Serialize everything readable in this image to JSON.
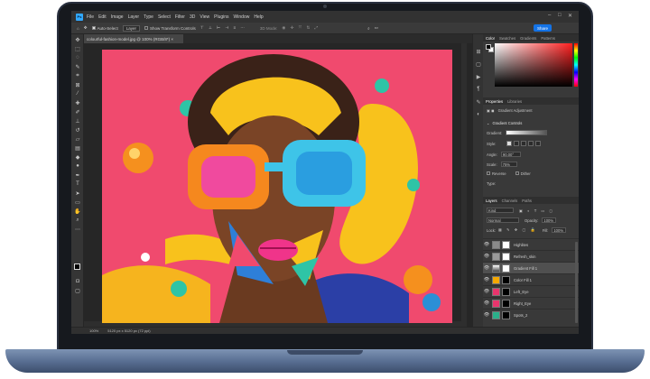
{
  "menubar": {
    "app_logo": "Ps",
    "items": [
      "File",
      "Edit",
      "Image",
      "Layer",
      "Type",
      "Select",
      "Filter",
      "3D",
      "View",
      "Plugins",
      "Window",
      "Help"
    ],
    "window_controls": [
      "–",
      "□",
      "✕"
    ]
  },
  "options_bar": {
    "auto_select_label": "Auto-Select",
    "auto_select_target": "Layer",
    "transform_label": "Show Transform Controls",
    "mode_3d_label": "3D Mode:",
    "share_label": "Share"
  },
  "document": {
    "tab_title": "colourful-fashion-model.jpg @ 100% (RGB/8*) ×",
    "zoom": "100%",
    "dimensions": "5120 px x 5120 px (72 ppi)"
  },
  "color_panel": {
    "tabs": [
      "Color",
      "Swatches",
      "Gradients",
      "Patterns"
    ],
    "active": "Color"
  },
  "properties_panel": {
    "tabs": [
      "Properties",
      "Libraries"
    ],
    "active": "Properties",
    "adjustment_label": "Gradient Adjustment",
    "section_label": "Gradient Controls",
    "gradient_label": "Gradient:",
    "style_label": "Style:",
    "angle_label": "Angle:",
    "angle_value": "90.00°",
    "scale_label": "Scale:",
    "scale_value": "75%",
    "reverse_label": "Reverse",
    "dither_label": "Dither",
    "type_label": "Type:"
  },
  "layers_panel": {
    "tabs": [
      "Layers",
      "Channels",
      "Paths"
    ],
    "active": "Layers",
    "filter_label": "Kind",
    "blend_mode": "Normal",
    "opacity_label": "Opacity:",
    "opacity_value": "100%",
    "lock_label": "Lock:",
    "fill_label": "Fill:",
    "fill_value": "100%",
    "layers": [
      {
        "name": "Highlites",
        "thumb": "#8a8a8a",
        "selected": false
      },
      {
        "name": "Refresh_skin",
        "thumb": "#9a9a9a",
        "selected": false
      },
      {
        "name": "Gradient Fill 1",
        "thumb": "#b0b0b0",
        "selected": true
      },
      {
        "name": "Color Fill 1",
        "thumb": "#f5a800",
        "selected": false
      },
      {
        "name": "Left_Eye",
        "thumb": "#e8356d",
        "selected": false
      },
      {
        "name": "Right_Eye",
        "thumb": "#e8356d",
        "selected": false
      },
      {
        "name": "Spots_2",
        "thumb": "#2ab08a",
        "selected": false
      }
    ]
  },
  "icons": {
    "toolbar": [
      "move-icon",
      "marquee-icon",
      "lasso-icon",
      "quick-select-icon",
      "crop-icon",
      "frame-icon",
      "eyedropper-icon",
      "healing-icon",
      "brush-icon",
      "stamp-icon",
      "history-brush-icon",
      "eraser-icon",
      "gradient-icon",
      "blur-icon",
      "dodge-icon",
      "pen-icon",
      "type-icon",
      "path-select-icon",
      "shape-icon",
      "hand-icon",
      "zoom-icon",
      "more-icon"
    ]
  }
}
